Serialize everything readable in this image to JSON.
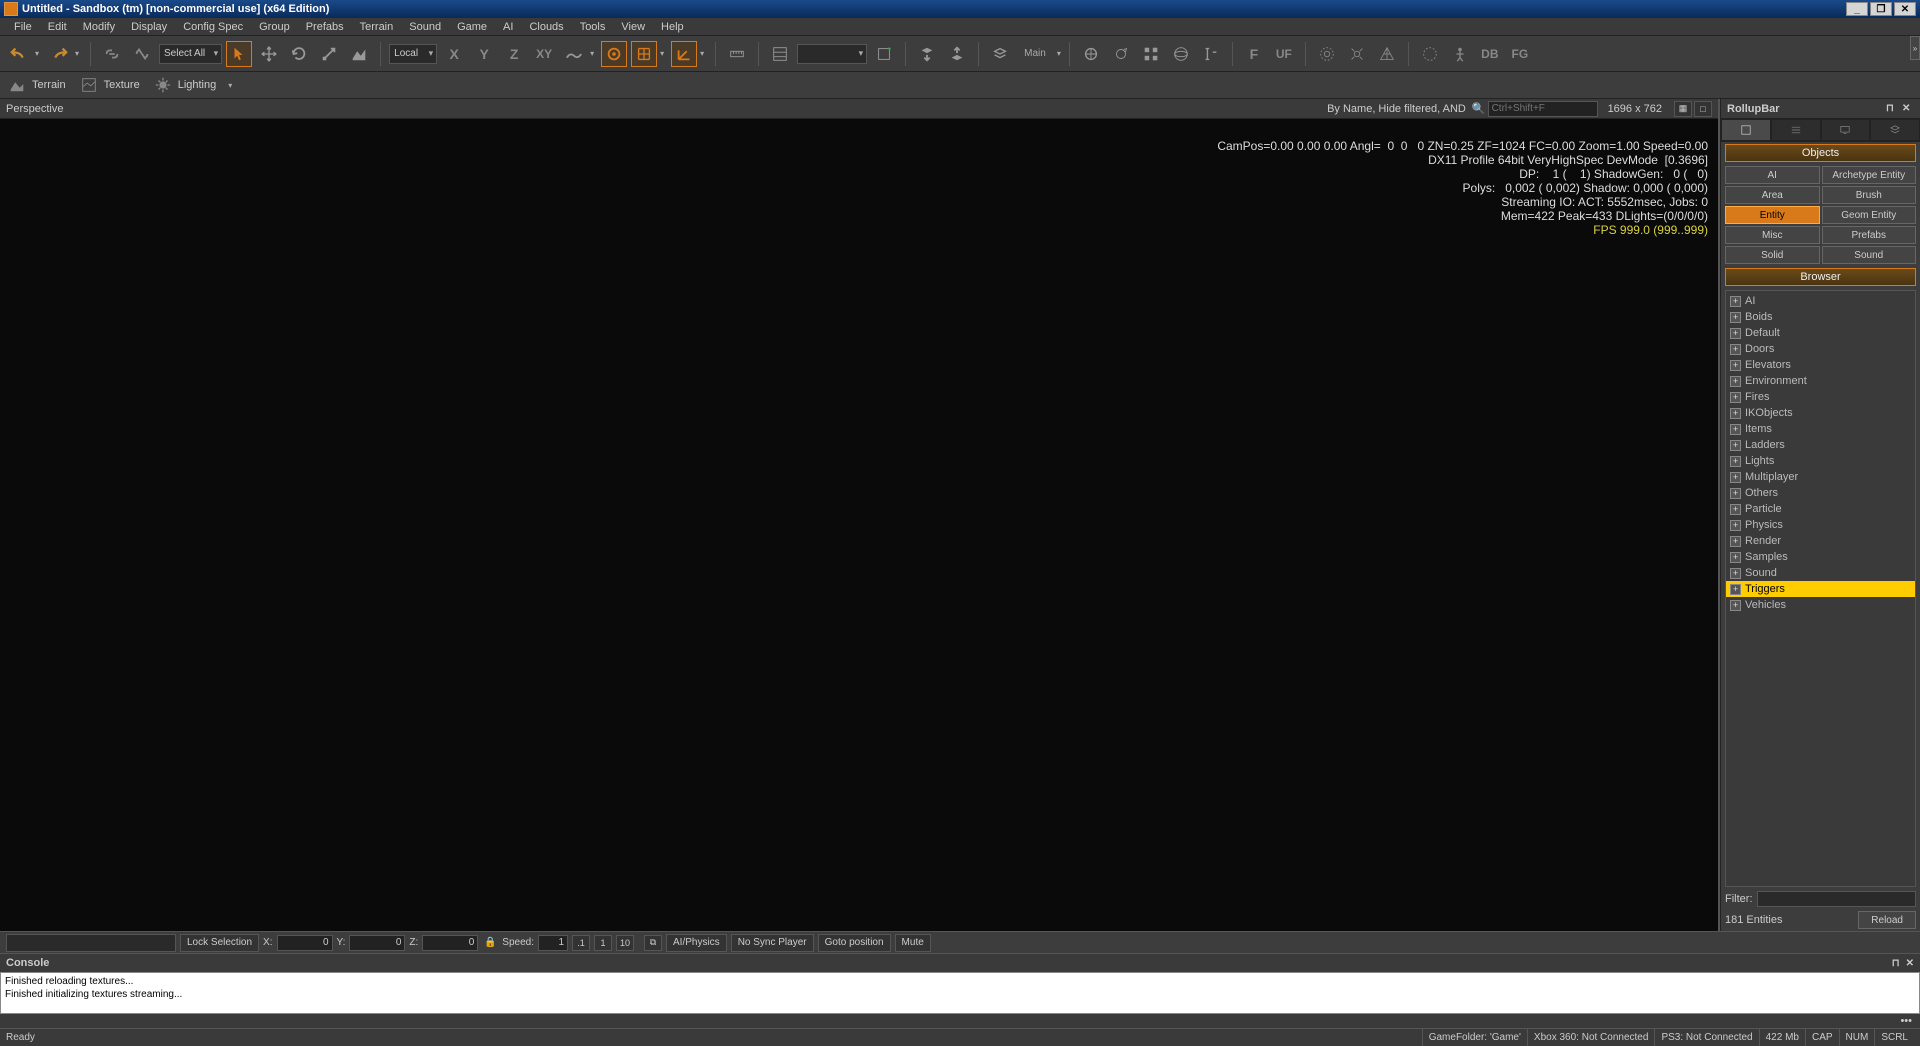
{
  "title": "Untitled - Sandbox (tm) [non-commercial use] (x64 Edition)",
  "menu": [
    "File",
    "Edit",
    "Modify",
    "Display",
    "Config Spec",
    "Group",
    "Prefabs",
    "Terrain",
    "Sound",
    "Game",
    "AI",
    "Clouds",
    "Tools",
    "View",
    "Help"
  ],
  "toolbar": {
    "select_filter": "Select All",
    "coord_system": "Local",
    "layer": "Main"
  },
  "toolbar2": {
    "terrain": "Terrain",
    "texture": "Texture",
    "lighting": "Lighting"
  },
  "viewport": {
    "name": "Perspective",
    "filter_text": "By Name, Hide filtered, AND",
    "search_placeholder": "Ctrl+Shift+F",
    "dimensions": "1696 x 762",
    "overlay": {
      "l1": "CamPos=0.00 0.00 0.00 Angl=  0  0   0 ZN=0.25 ZF=1024 FC=0.00 Zoom=1.00 Speed=0.00",
      "l2": "DX11 Profile 64bit VeryHighSpec DevMode  [0.3696]",
      "l3": "DP:    1 (    1) ShadowGen:   0 (   0)",
      "l4": "Polys:   0,002 ( 0,002) Shadow: 0,000 ( 0,000)",
      "l5": "Streaming IO: ACT: 5552msec, Jobs: 0",
      "l6": "Mem=422 Peak=433 DLights=(0/0/0/0)",
      "fps": "FPS 999.0 (999..999)"
    }
  },
  "rollup": {
    "title": "RollupBar",
    "objects_head": "Objects",
    "browser_head": "Browser",
    "object_types": [
      "AI",
      "Archetype Entity",
      "Area",
      "Brush",
      "Entity",
      "Geom Entity",
      "Misc",
      "Prefabs",
      "Solid",
      "Sound"
    ],
    "active_type": "Entity",
    "tree": [
      "AI",
      "Boids",
      "Default",
      "Doors",
      "Elevators",
      "Environment",
      "Fires",
      "IKObjects",
      "Items",
      "Ladders",
      "Lights",
      "Multiplayer",
      "Others",
      "Particle",
      "Physics",
      "Render",
      "Samples",
      "Sound",
      "Triggers",
      "Vehicles"
    ],
    "selected_tree": "Triggers",
    "filter_label": "Filter:",
    "entity_count": "181 Entities",
    "reload": "Reload"
  },
  "coord": {
    "lock_sel": "Lock Selection",
    "x": "X:",
    "xv": "0",
    "y": "Y:",
    "yv": "0",
    "z": "Z:",
    "zv": "0",
    "speed": "Speed:",
    "speedv": "1",
    "p1": ".1",
    "p2": "1",
    "p3": "10",
    "ai": "AI/Physics",
    "nosync": "No Sync Player",
    "goto": "Goto position",
    "mute": "Mute"
  },
  "console": {
    "title": "Console",
    "lines": [
      "Finished reloading textures...",
      "Finished initializing textures streaming..."
    ]
  },
  "status": {
    "ready": "Ready",
    "gamefolder": "GameFolder: 'Game'",
    "xbox": "Xbox 360: Not Connected",
    "ps3": "PS3: Not Connected",
    "mem": "422 Mb",
    "cap": "CAP",
    "num": "NUM",
    "scrl": "SCRL"
  }
}
